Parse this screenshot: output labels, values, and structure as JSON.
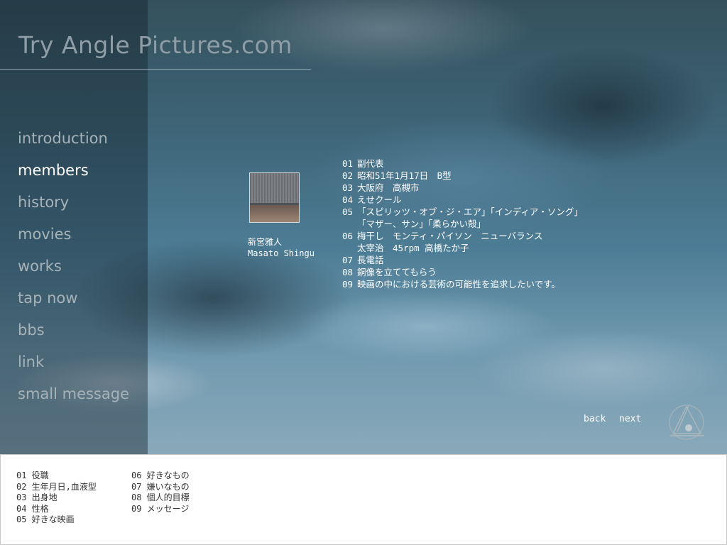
{
  "site": {
    "logo": "Try Angle Pictures.com"
  },
  "nav": {
    "items": [
      {
        "label": "introduction"
      },
      {
        "label": "members"
      },
      {
        "label": "history"
      },
      {
        "label": "movies"
      },
      {
        "label": "works"
      },
      {
        "label": "tap now"
      },
      {
        "label": "bbs"
      },
      {
        "label": "link"
      },
      {
        "label": "small message"
      }
    ],
    "active": "members"
  },
  "member": {
    "name_ja": "新宮雅人",
    "name_en": "Masato Shingu",
    "answers": [
      {
        "num": "01",
        "text": "副代表"
      },
      {
        "num": "02",
        "text": "昭和51年1月17日　B型"
      },
      {
        "num": "03",
        "text": "大阪府　高槻市"
      },
      {
        "num": "04",
        "text": "えせクール"
      },
      {
        "num": "05",
        "text": "「スピリッツ・オブ・ジ・エア」「インディア・ソング」",
        "cont": "「マザー、サン」「柔らかい殻」"
      },
      {
        "num": "06",
        "text": "梅干し　モンティ・パイソン　ニューバランス",
        "cont": "太宰治　45rpm 高橋たか子"
      },
      {
        "num": "07",
        "text": "長電話"
      },
      {
        "num": "08",
        "text": "銅像を立ててもらう"
      },
      {
        "num": "09",
        "text": "映画の中における芸術の可能性を追求したいです。"
      }
    ]
  },
  "pager": {
    "back": "back",
    "next": "next"
  },
  "legend": {
    "col1": [
      "01 役職",
      "02 生年月日,血液型",
      "03 出身地",
      "04 性格",
      "05 好きな映画"
    ],
    "col2": [
      "06 好きなもの",
      "07 嫌いなもの",
      "08 個人的目標",
      "09 メッセージ"
    ]
  }
}
